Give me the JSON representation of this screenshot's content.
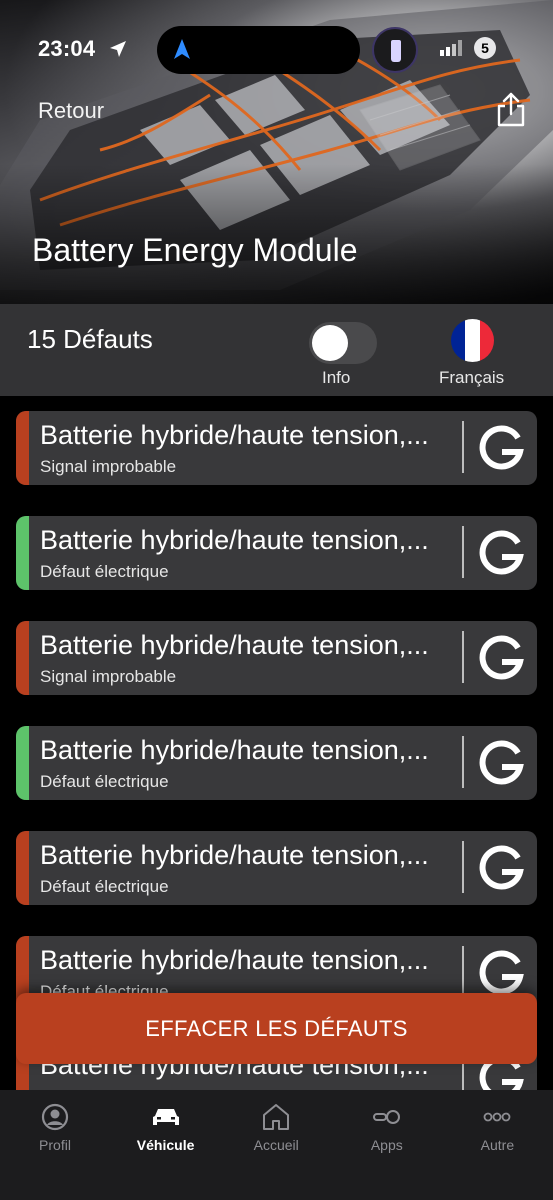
{
  "status_bar": {
    "time": "23:04",
    "battery_glyph": "5"
  },
  "header": {
    "back_label": "Retour",
    "title": "Battery Energy Module",
    "share_icon": "share-icon"
  },
  "summary": {
    "fault_count_label": "15 Défauts",
    "info_toggle_label": "Info",
    "info_toggle_on": false,
    "language_label": "Français",
    "flag_colors": [
      "#002395",
      "#ffffff",
      "#ed2939"
    ]
  },
  "faults": [
    {
      "title": "Batterie hybride/haute tension,...",
      "subtitle": "Signal improbable",
      "severity_color": "#b9401f"
    },
    {
      "title": "Batterie hybride/haute tension,...",
      "subtitle": "Défaut électrique",
      "severity_color": "#5dc36a"
    },
    {
      "title": "Batterie hybride/haute tension,...",
      "subtitle": "Signal improbable",
      "severity_color": "#b9401f"
    },
    {
      "title": "Batterie hybride/haute tension,...",
      "subtitle": "Défaut électrique",
      "severity_color": "#5dc36a"
    },
    {
      "title": "Batterie hybride/haute tension,...",
      "subtitle": "Défaut électrique",
      "severity_color": "#b9401f"
    },
    {
      "title": "Batterie hybride/haute tension,...",
      "subtitle": "Défaut électrique",
      "severity_color": "#b9401f"
    },
    {
      "title": "Batterie hybride/haute tension,...",
      "subtitle": "",
      "severity_color": "#b9401f"
    }
  ],
  "clear_button_label": "EFFACER LES DÉFAUTS",
  "colors": {
    "accent": "#b9401f",
    "ok": "#5dc36a",
    "card_bg": "#39393b",
    "tab_bar_bg": "#1c1c1e"
  },
  "tabs": [
    {
      "label": "Profil",
      "icon": "profile-icon",
      "active": false
    },
    {
      "label": "Véhicule",
      "icon": "car-icon",
      "active": true
    },
    {
      "label": "Accueil",
      "icon": "home-icon",
      "active": false
    },
    {
      "label": "Apps",
      "icon": "apps-icon",
      "active": false
    },
    {
      "label": "Autre",
      "icon": "more-icon",
      "active": false
    }
  ]
}
